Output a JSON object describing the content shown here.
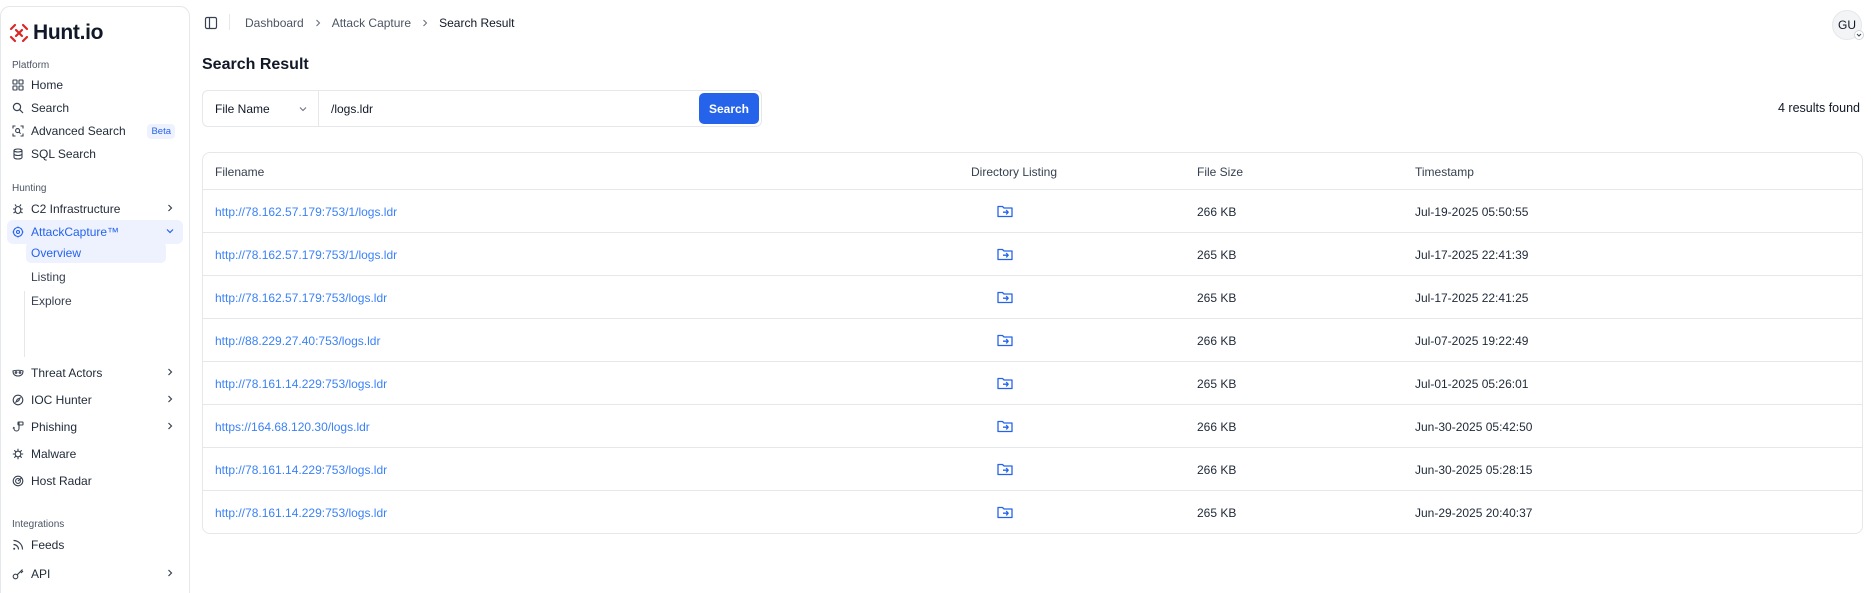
{
  "brand": {
    "name": "Hunt.io"
  },
  "sidebar": {
    "sections": [
      {
        "label": "Platform"
      },
      {
        "label": "Hunting"
      },
      {
        "label": "Integrations"
      }
    ],
    "items": {
      "home": {
        "label": "Home"
      },
      "search": {
        "label": "Search"
      },
      "advanced_search": {
        "label": "Advanced Search",
        "badge": "Beta"
      },
      "sql_search": {
        "label": "SQL Search"
      },
      "c2": {
        "label": "C2 Infrastructure"
      },
      "attackcapture": {
        "label": "AttackCapture™"
      },
      "threat_actors": {
        "label": "Threat Actors"
      },
      "ioc_hunter": {
        "label": "IOC Hunter"
      },
      "phishing": {
        "label": "Phishing"
      },
      "malware": {
        "label": "Malware"
      },
      "host_radar": {
        "label": "Host Radar"
      },
      "feeds": {
        "label": "Feeds"
      },
      "api": {
        "label": "API"
      }
    },
    "sub_items": {
      "overview": {
        "label": "Overview"
      },
      "listing": {
        "label": "Listing"
      },
      "explore": {
        "label": "Explore"
      }
    }
  },
  "breadcrumb": [
    "Dashboard",
    "Attack Capture",
    "Search Result"
  ],
  "user": {
    "initials": "GU"
  },
  "page": {
    "title": "Search Result"
  },
  "search": {
    "field": "File Name",
    "query": "/logs.ldr",
    "button": "Search",
    "results_count": "4 results found"
  },
  "table": {
    "headers": [
      "Filename",
      "Directory Listing",
      "File Size",
      "Timestamp"
    ],
    "rows": [
      {
        "filename": "http://78.162.57.179:753/1/logs.ldr",
        "size": "266 KB",
        "timestamp": "Jul-19-2025 05:50:55"
      },
      {
        "filename": "http://78.162.57.179:753/1/logs.ldr",
        "size": "265 KB",
        "timestamp": "Jul-17-2025 22:41:39"
      },
      {
        "filename": "http://78.162.57.179:753/logs.ldr",
        "size": "265 KB",
        "timestamp": "Jul-17-2025 22:41:25"
      },
      {
        "filename": "http://88.229.27.40:753/logs.ldr",
        "size": "266 KB",
        "timestamp": "Jul-07-2025 19:22:49"
      },
      {
        "filename": "http://78.161.14.229:753/logs.ldr",
        "size": "265 KB",
        "timestamp": "Jul-01-2025 05:26:01"
      },
      {
        "filename": "https://164.68.120.30/logs.ldr",
        "size": "266 KB",
        "timestamp": "Jun-30-2025 05:42:50"
      },
      {
        "filename": "http://78.161.14.229:753/logs.ldr",
        "size": "266 KB",
        "timestamp": "Jun-30-2025 05:28:15"
      },
      {
        "filename": "http://78.161.14.229:753/logs.ldr",
        "size": "265 KB",
        "timestamp": "Jun-29-2025 20:40:37"
      }
    ]
  },
  "colors": {
    "accent": "#2563eb",
    "link": "#3b82f6",
    "brand_red": "#dc2626",
    "active_bg": "#eef2ff"
  }
}
